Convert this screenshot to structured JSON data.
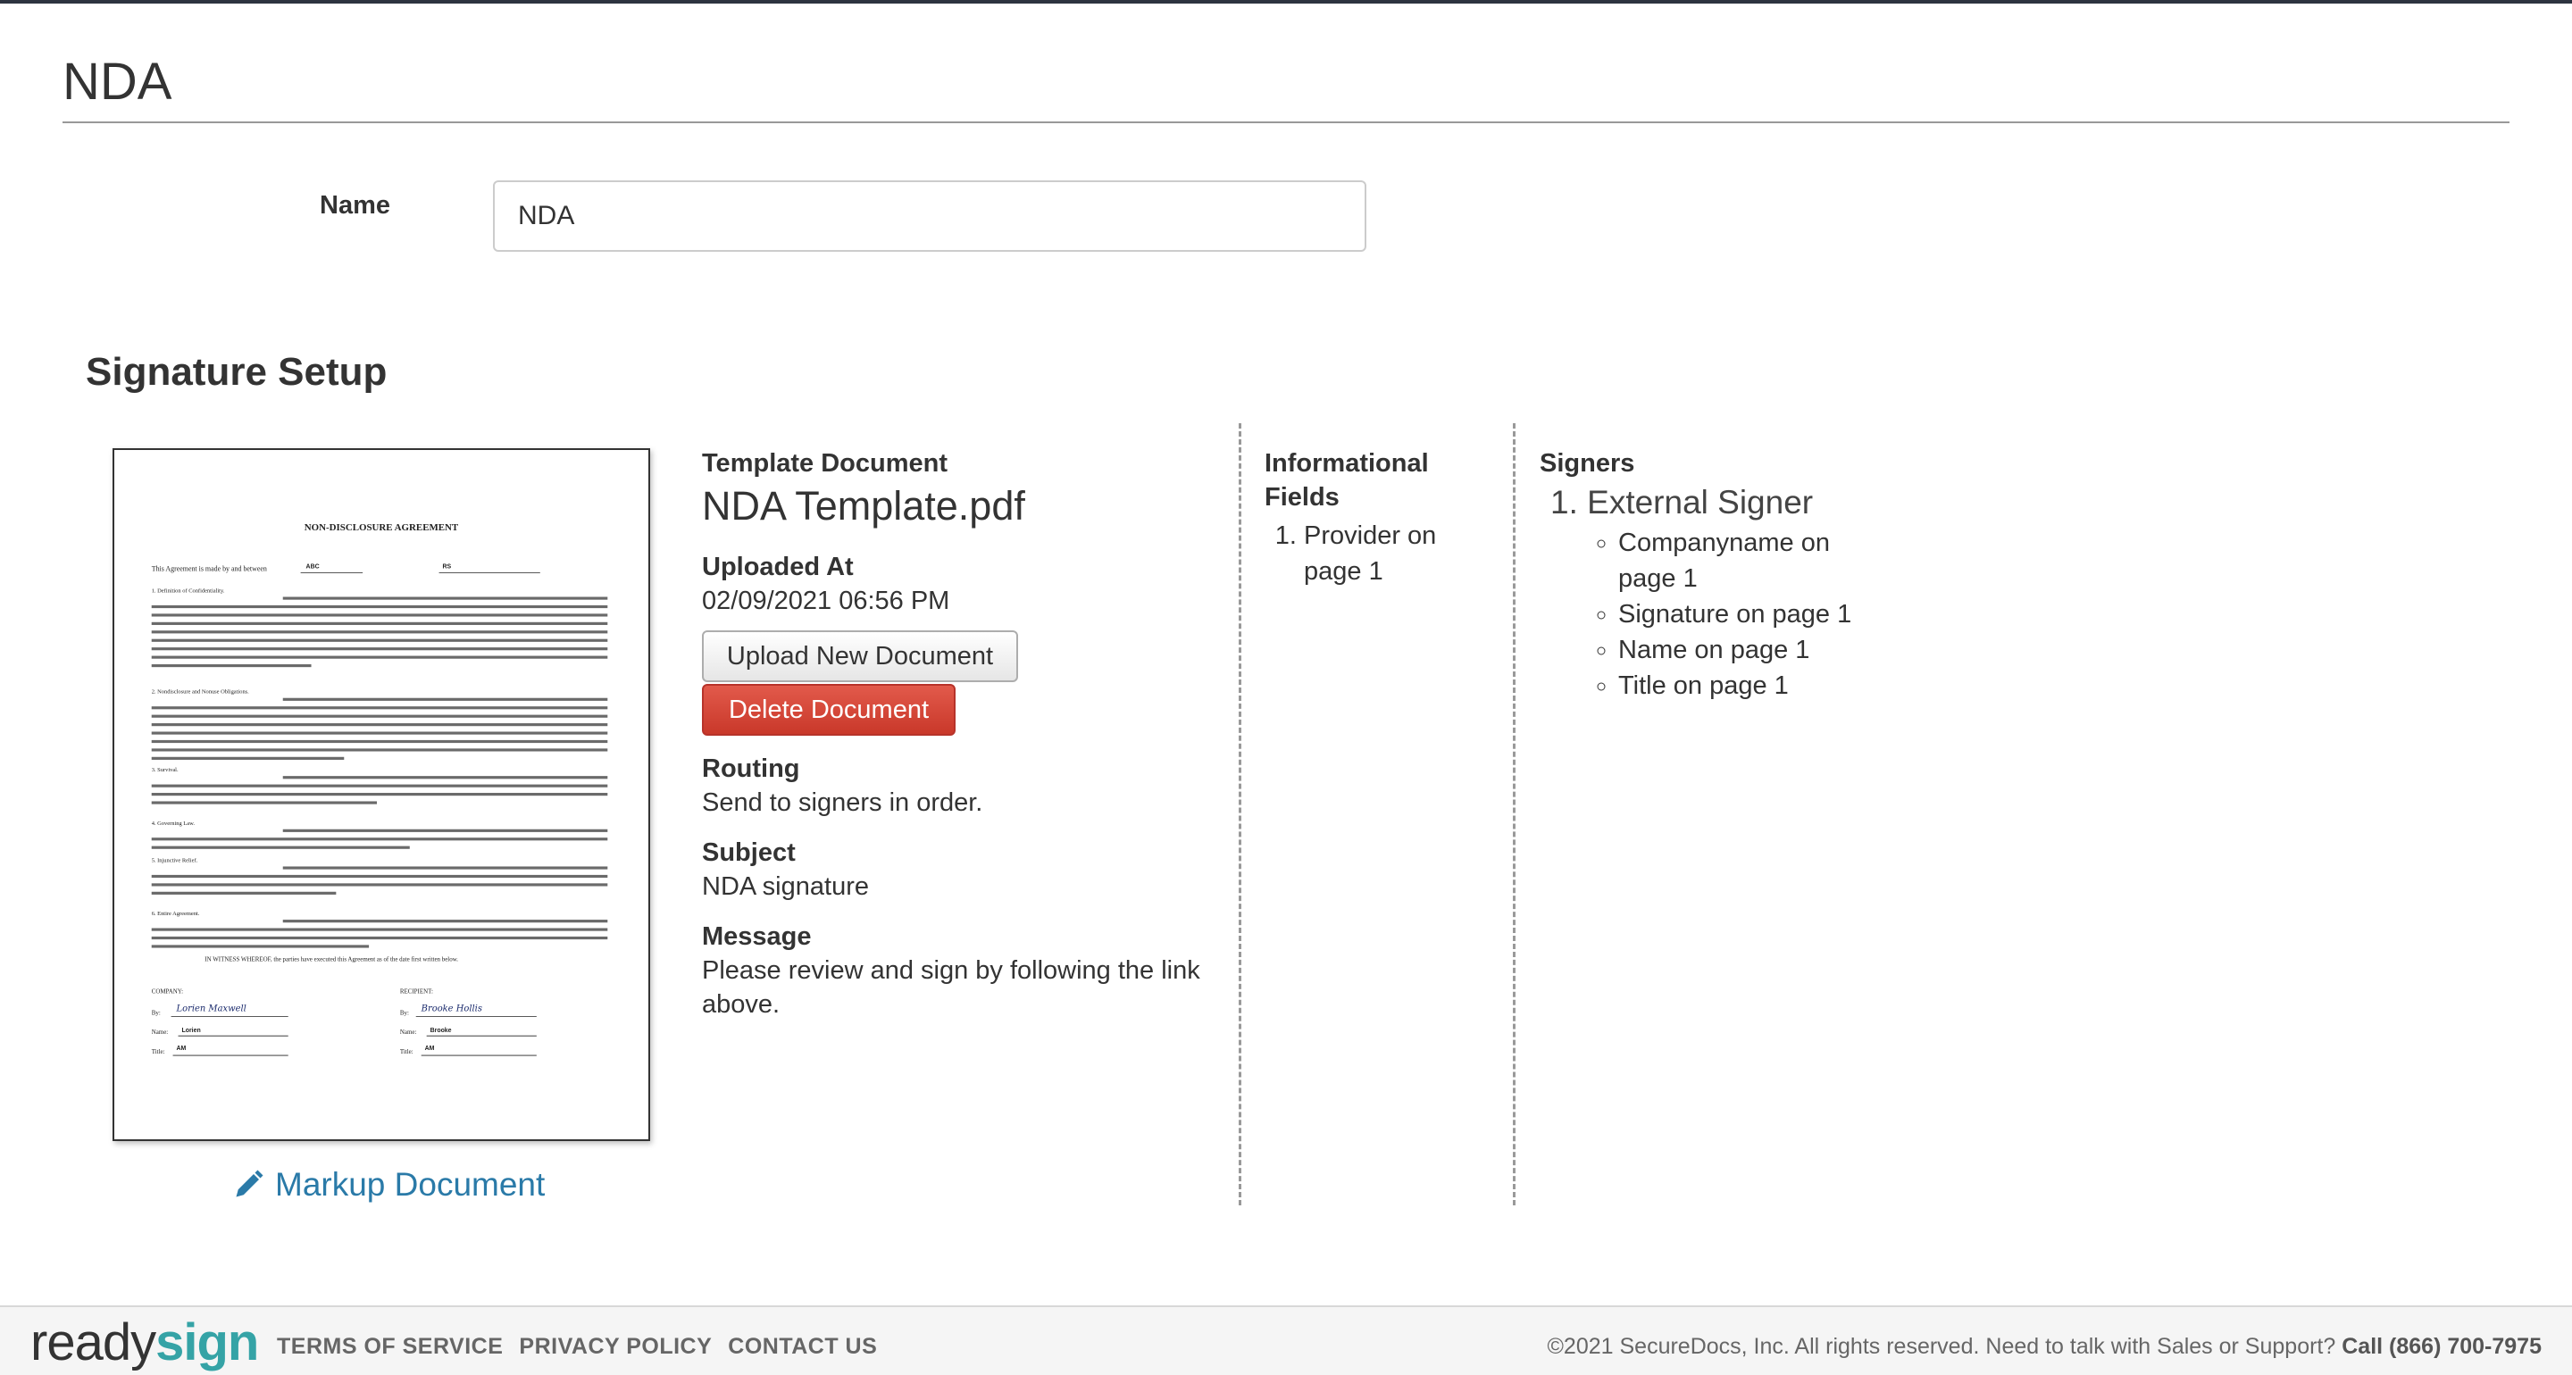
{
  "page": {
    "title": "NDA"
  },
  "form": {
    "name_label": "Name",
    "name_value": "NDA"
  },
  "signature_setup": {
    "title": "Signature Setup",
    "markup_link": "Markup Document",
    "template": {
      "label": "Template Document",
      "file_name": "NDA Template.pdf",
      "uploaded_label": "Uploaded At",
      "uploaded_value": "02/09/2021 06:56 PM",
      "upload_button": "Upload New Document",
      "delete_button": "Delete Document"
    },
    "routing": {
      "label": "Routing",
      "value": "Send to signers in order."
    },
    "subject": {
      "label": "Subject",
      "value": "NDA signature"
    },
    "message": {
      "label": "Message",
      "value": "Please review and sign by following the link above."
    },
    "informational_fields": {
      "label": "Informational Fields",
      "items": [
        "Provider on page 1"
      ]
    },
    "signers": {
      "label": "Signers",
      "list": [
        {
          "name": "External Signer",
          "fields": [
            "Companyname on page 1",
            "Signature on page 1",
            "Name on page 1",
            "Title on page 1"
          ]
        }
      ]
    }
  },
  "document_preview": {
    "heading": "NON-DISCLOSURE AGREEMENT",
    "intro": "This Agreement is made by and between",
    "party_a": "ABC",
    "party_b": "RS",
    "witness": "IN WITNESS WHEREOF, the parties have executed this Agreement as of the date first written below.",
    "company_label": "COMPANY:",
    "recipient_label": "RECIPIENT:",
    "by_label": "By:",
    "name_label": "Name:",
    "title_label": "Title:",
    "company_name": "Lorien",
    "recipient_name": "Brooke",
    "company_title": "AM",
    "recipient_title": "AM",
    "company_signature": "Lorien Maxwell",
    "recipient_signature": "Brooke Hollis",
    "sections": [
      "1. Definition of Confidentiality.",
      "2. Nondisclosure and Nonuse Obligations.",
      "3. Survival.",
      "4. Governing Law.",
      "5. Injunctive Relief.",
      "6. Entire Agreement."
    ]
  },
  "footer": {
    "logo_ready": "ready",
    "logo_sign": "sign",
    "links": [
      "TERMS OF SERVICE",
      "PRIVACY POLICY",
      "CONTACT US"
    ],
    "copyright": "©2021 SecureDocs, Inc. All rights reserved. Need to talk with Sales or Support?",
    "phone": "Call (866) 700-7975"
  },
  "colors": {
    "link": "#2a7aa8",
    "danger": "#d24a3b",
    "brand_teal": "#35a3a6",
    "topbar": "#2d3440"
  }
}
